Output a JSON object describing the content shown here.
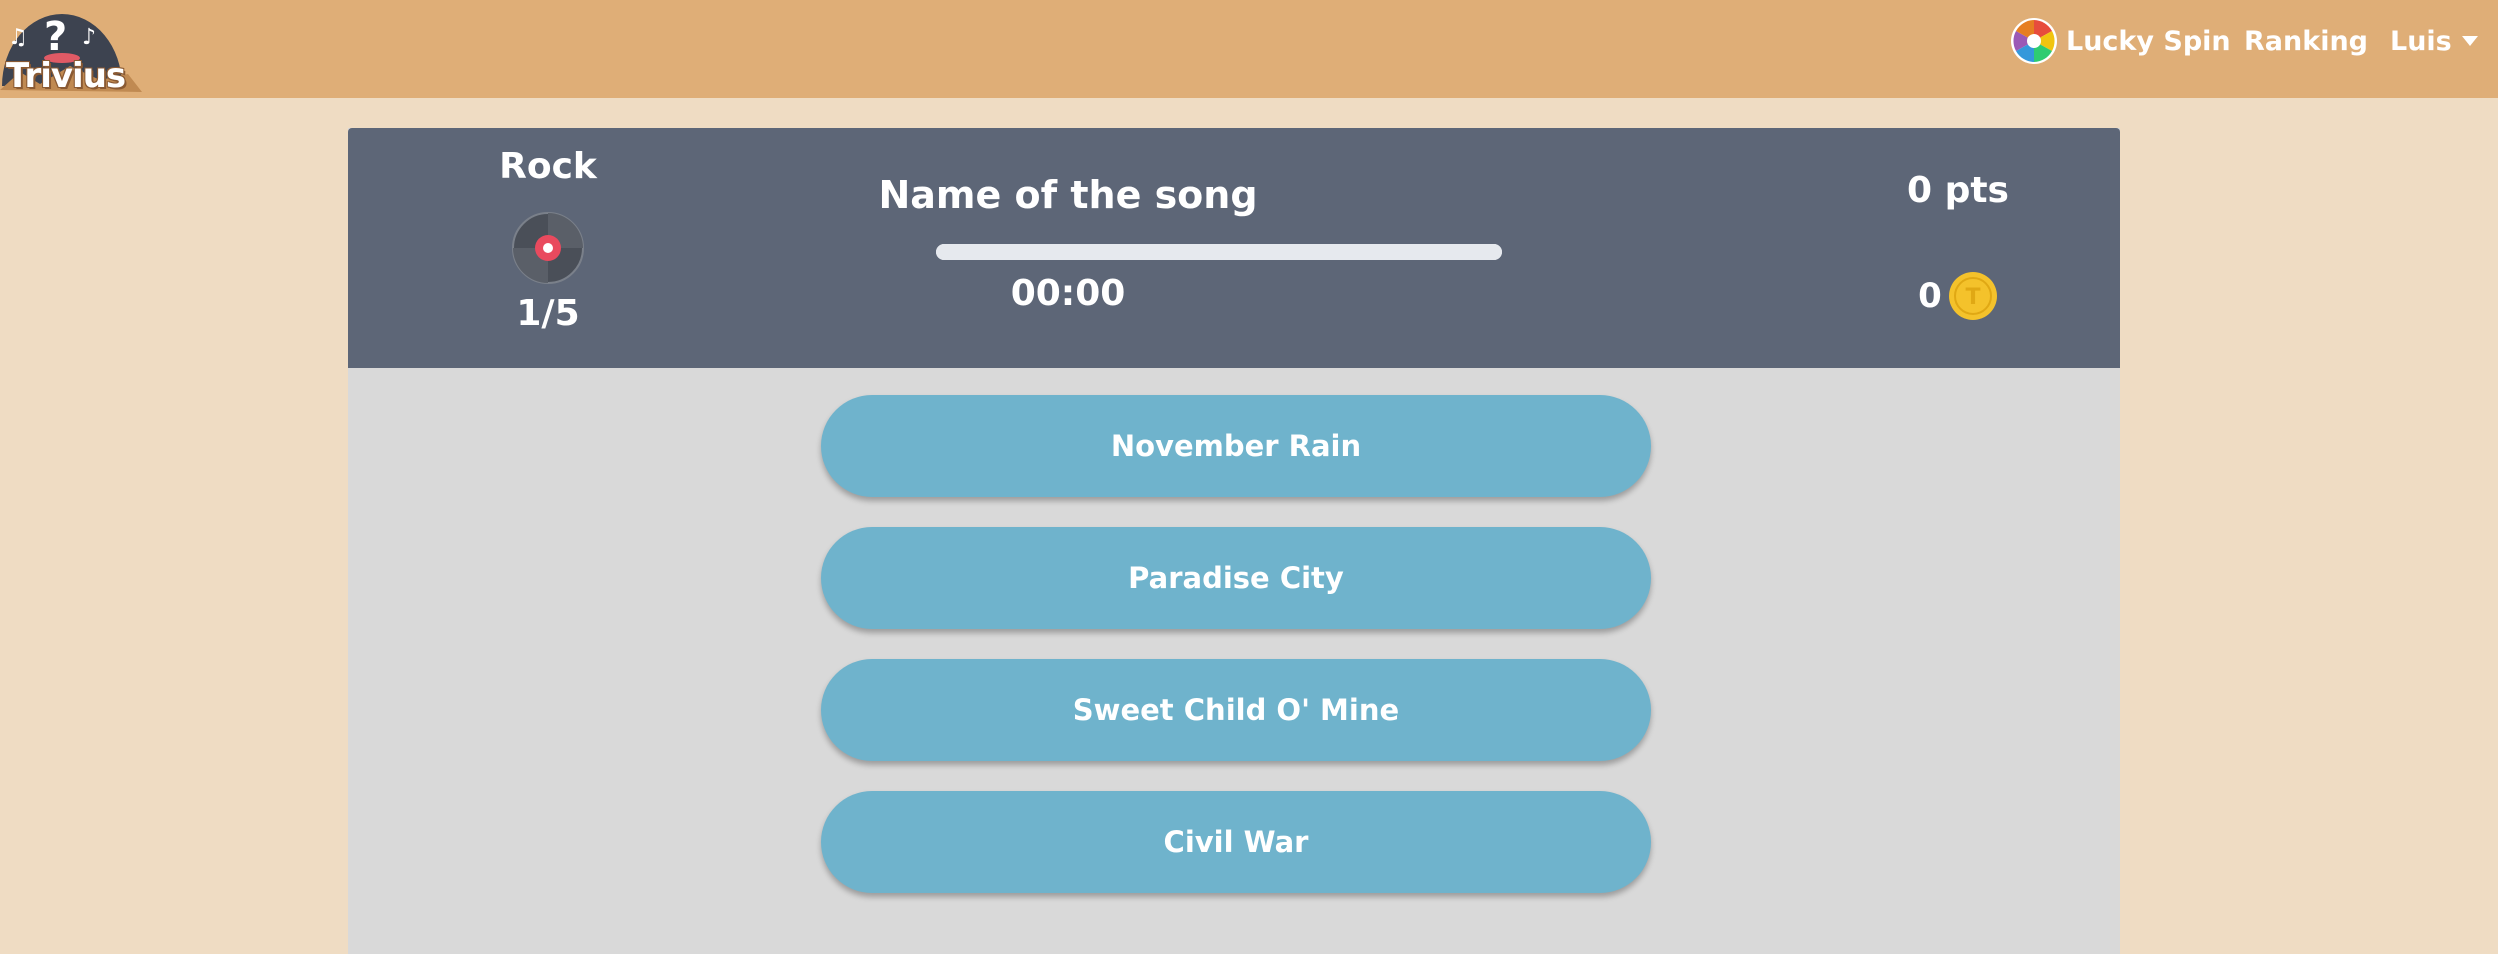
{
  "nav": {
    "logo_text": "Trivius",
    "lucky_spin": "Lucky Spin",
    "ranking": "Ranking",
    "user": "Luis"
  },
  "game": {
    "category": "Rock",
    "category_icon": "vinyl-record-icon",
    "progress": "1/5",
    "question": "Name of the song",
    "timer": "00:00",
    "timer_fraction": 1.0,
    "points": "0 pts",
    "coins": "0",
    "coin_icon": "coin-icon",
    "answers": [
      "November Rain",
      "Paradise City",
      "Sweet Child O' Mine",
      "Civil War"
    ]
  },
  "colors": {
    "navbar": "#dfae77",
    "background": "#efdcc3",
    "header": "#5d6677",
    "answer": "#6fb3cc",
    "coin": "#f4c22b"
  }
}
